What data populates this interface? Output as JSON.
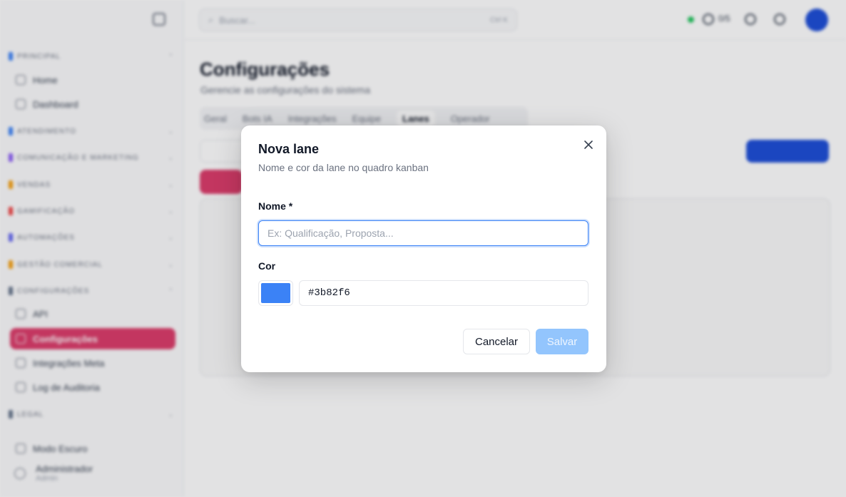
{
  "sidebar": {
    "sections": [
      {
        "label": "PRINCIPAL",
        "color": "#3b82f6"
      },
      {
        "label": "ATENDIMENTO",
        "color": "#3b82f6"
      },
      {
        "label": "COMUNICAÇÃO E MARKETING",
        "color": "#8b5cf6"
      },
      {
        "label": "VENDAS",
        "color": "#f59e0b"
      },
      {
        "label": "GAMIFICAÇÃO",
        "color": "#ef4444"
      },
      {
        "label": "AUTOMAÇÕES",
        "color": "#6366f1"
      },
      {
        "label": "GESTÃO COMERCIAL",
        "color": "#f59e0b"
      },
      {
        "label": "CONFIGURAÇÕES",
        "color": "#64748b"
      },
      {
        "label": "LEGAL",
        "color": "#64748b"
      }
    ],
    "items": {
      "home": "Home",
      "dashboard": "Dashboard",
      "api": "API",
      "configuracoes": "Configurações",
      "integracao_meta": "Integrações Meta",
      "log_auditoria": "Log de Auditoria",
      "modo_escuro": "Modo Escuro"
    },
    "user": {
      "name": "Administrador",
      "role": "Admin"
    }
  },
  "topbar": {
    "search_placeholder": "Buscar...",
    "shortcut": "Ctrl K",
    "count": "0/5"
  },
  "page": {
    "title": "Configurações",
    "subtitle": "Gerencie as configurações do sistema",
    "tabs": [
      "Geral",
      "Bots IA",
      "Integrações",
      "Equipe",
      "Lanes",
      "Operador"
    ],
    "active_tab": "Lanes"
  },
  "modal": {
    "title": "Nova lane",
    "description": "Nome e cor da lane no quadro kanban",
    "name_label": "Nome *",
    "name_placeholder": "Ex: Qualificação, Proposta...",
    "color_label": "Cor",
    "color_value": "#3b82f6",
    "cancel_label": "Cancelar",
    "save_label": "Salvar"
  }
}
